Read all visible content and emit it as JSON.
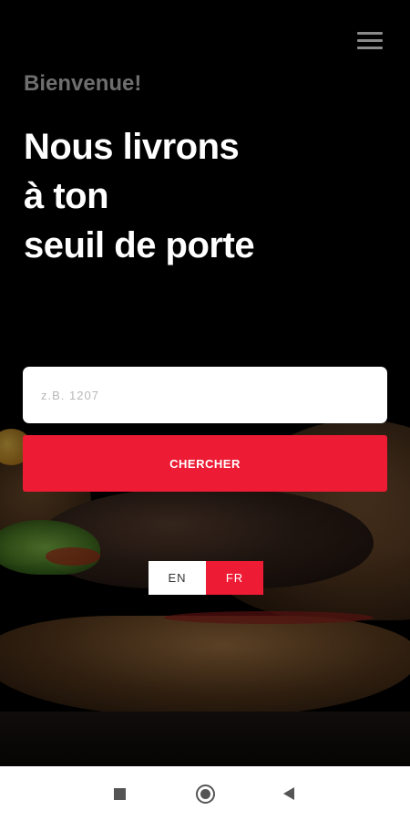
{
  "header": {
    "welcome": "Bienvenue!",
    "headline_lines": [
      "Nous livrons",
      "à ton",
      "seuil de porte"
    ]
  },
  "menu": {
    "icon": "hamburger-menu-icon"
  },
  "search": {
    "placeholder": "z.B. 1207",
    "value": "",
    "button_label": "CHERCHER"
  },
  "language": {
    "options": [
      "EN",
      "FR"
    ],
    "selected": "FR"
  },
  "navbar": {
    "icons": [
      "recent-apps-icon",
      "home-icon",
      "back-icon"
    ]
  },
  "colors": {
    "accent": "#ed1b34",
    "background": "#000000",
    "welcome_text": "#6e6e6e",
    "headline_text": "#ffffff"
  }
}
